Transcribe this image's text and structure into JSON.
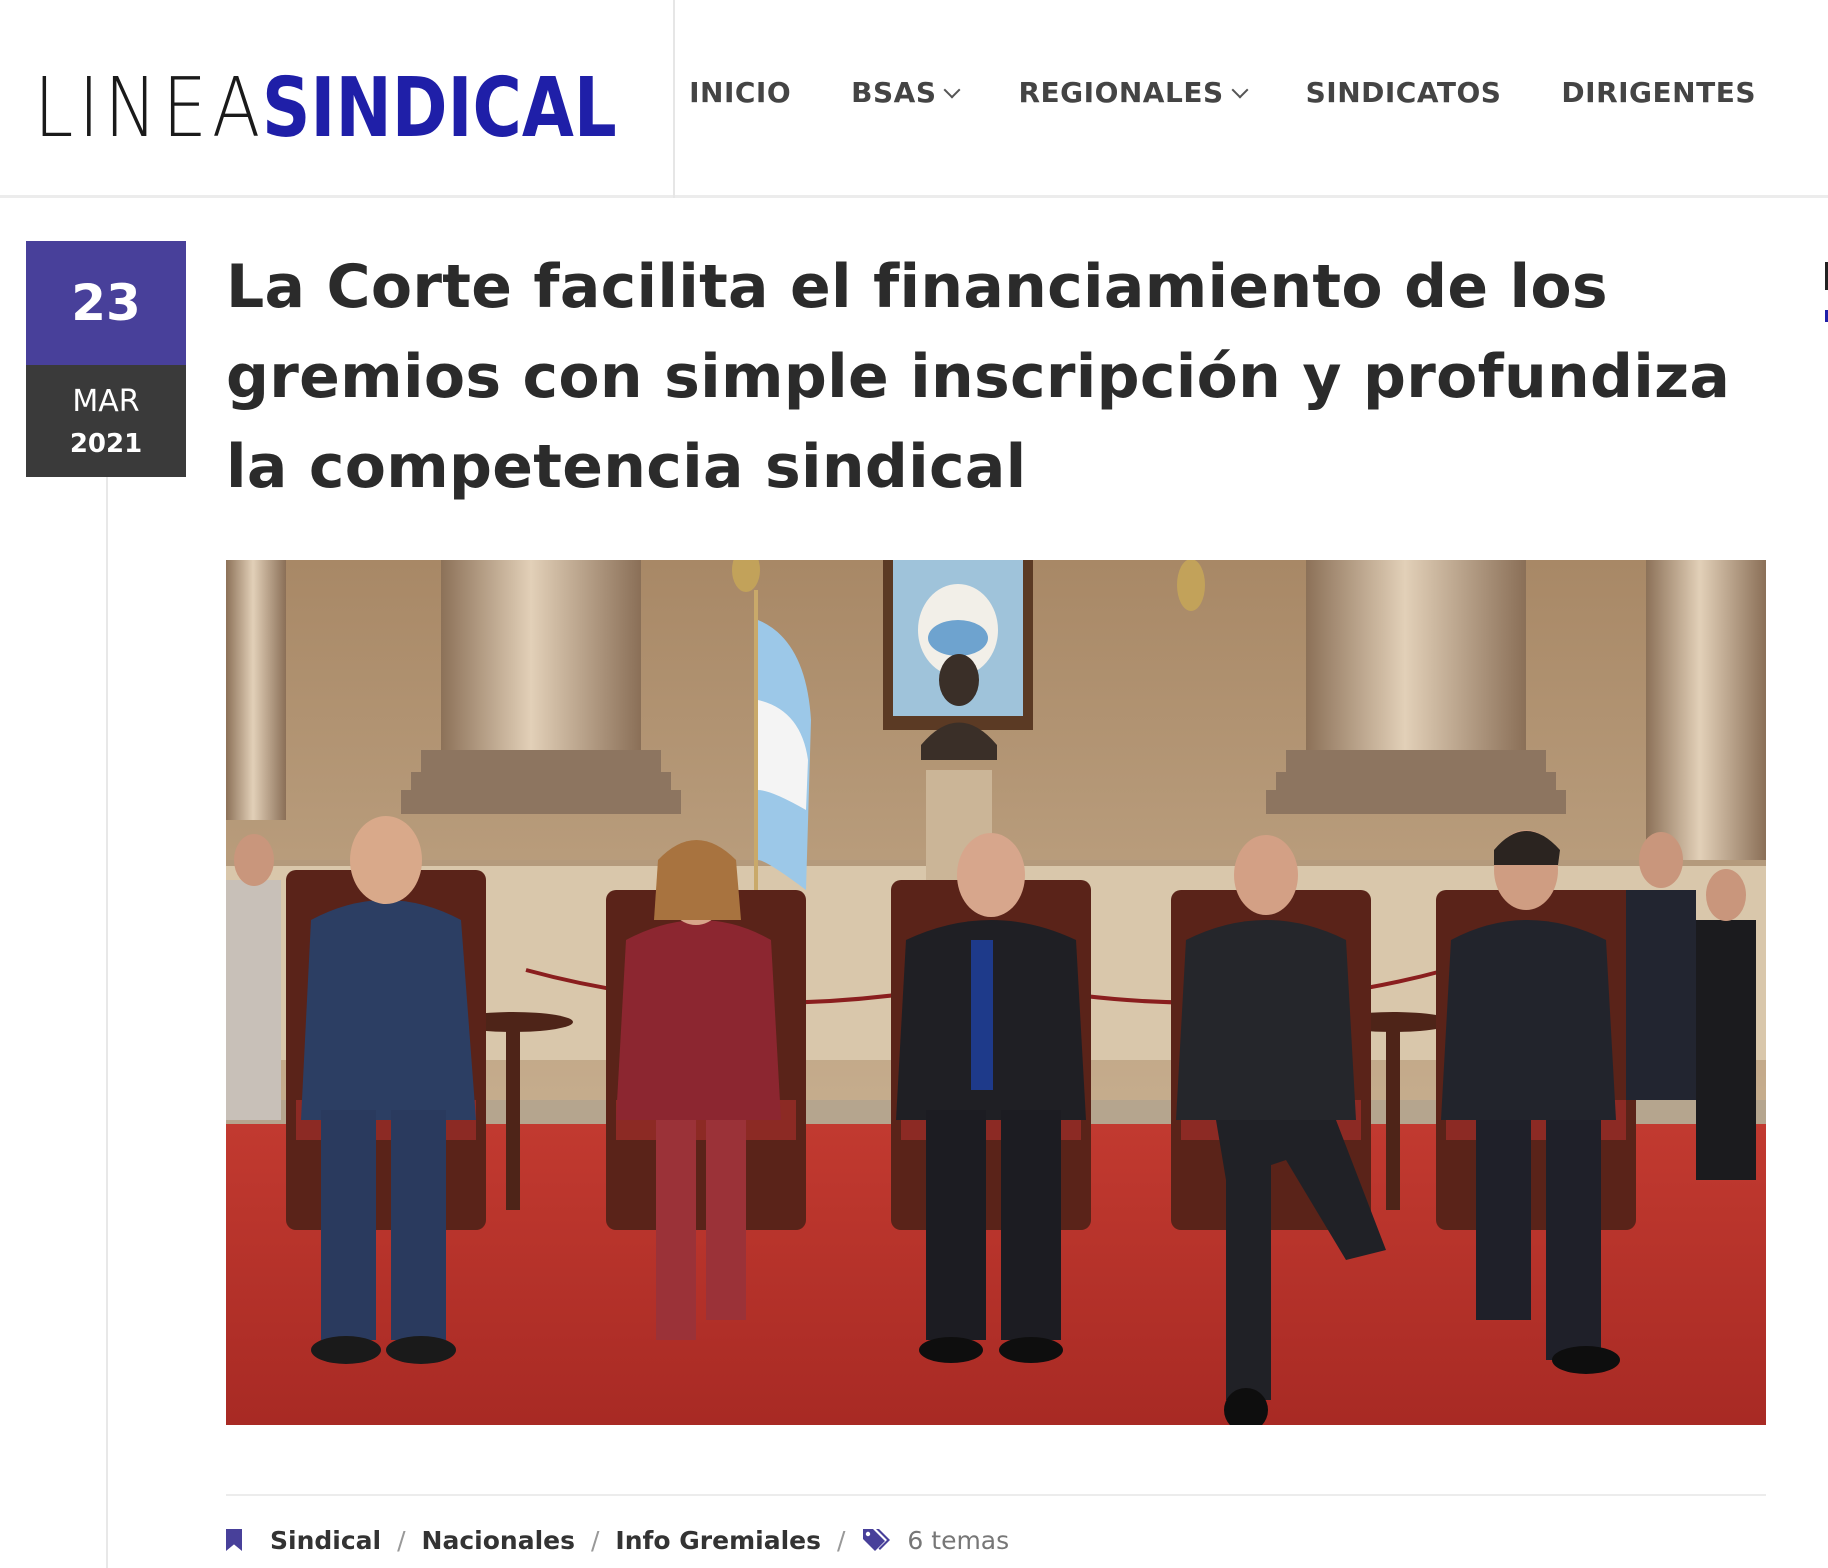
{
  "header": {
    "logo": {
      "light": "LINEA",
      "bold": "SINDICAL"
    },
    "nav": [
      {
        "label": "INICIO",
        "dropdown": false
      },
      {
        "label": "BSAS",
        "dropdown": true
      },
      {
        "label": "REGIONALES",
        "dropdown": true
      },
      {
        "label": "SINDICATOS",
        "dropdown": false
      },
      {
        "label": "DIRIGENTES",
        "dropdown": false
      }
    ]
  },
  "post": {
    "date": {
      "day": "23",
      "month": "MAR",
      "year": "2021"
    },
    "title": "La Corte facilita el financiamiento de los gremios con simple inscripción y profundiza la competencia sindical",
    "image_icon": "photo-court-justices",
    "meta": {
      "categories": [
        "Sindical",
        "Nacionales",
        "Info Gremiales"
      ],
      "separator": "/",
      "tags_count": "6 temas"
    }
  },
  "colors": {
    "brand_blue": "#1f1fa8",
    "accent_purple": "#48409a",
    "date_dark": "#3a3a3a",
    "title_text": "#2b2b2b",
    "carpet_red": "#b8322c"
  }
}
